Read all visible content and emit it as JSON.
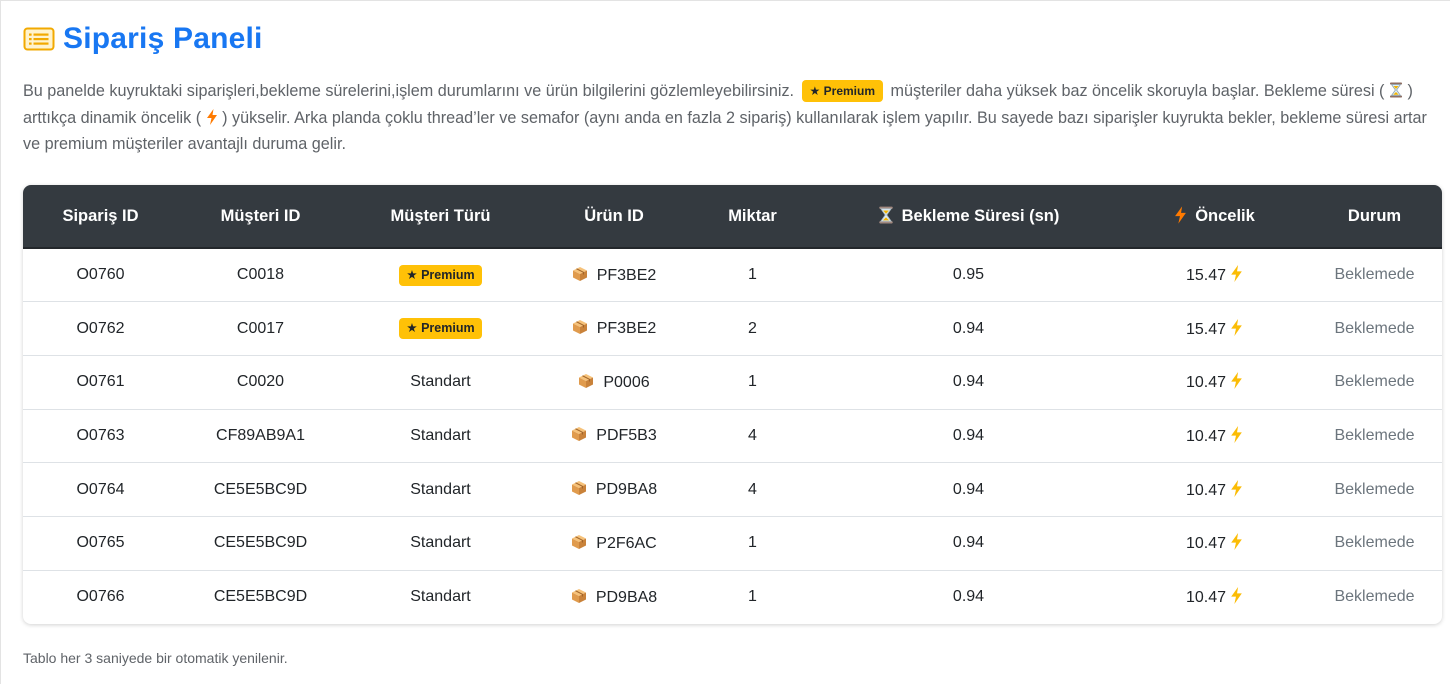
{
  "header": {
    "title": "Sipariş Paneli",
    "icon": "list-icon",
    "accent_color": "#1877f2"
  },
  "description": {
    "part1": "Bu panelde kuyruktaki siparişleri,bekleme sürelerini,işlem durumlarını ve ürün bilgilerini gözlemleyebilirsiniz.",
    "premium_badge": "★ Premium",
    "part2": "müşteriler daha yüksek baz öncelik skoruyla başlar. Bekleme süresi (",
    "part3": ") arttıkça dinamik öncelik (",
    "part4": ") yükselir. Arka planda çoklu thread’ler ve semafor (aynı anda en fazla 2 sipariş) kullanılarak işlem yapılır. Bu sayede bazı siparişler kuyrukta bekler, bekleme süresi artar ve premium müşteriler avantajlı duruma gelir."
  },
  "table": {
    "columns": [
      "Sipariş ID",
      "Müşteri ID",
      "Müşteri Türü",
      "Ürün ID",
      "Miktar",
      "Bekleme Süresi (sn)",
      "Öncelik",
      "Durum"
    ],
    "rows": [
      {
        "order_id": "O0760",
        "customer_id": "C0018",
        "customer_type": "★ Premium",
        "premium": true,
        "product_id": "PF3BE2",
        "quantity": "1",
        "wait": "0.95",
        "priority": "15.47",
        "status": "Beklemede"
      },
      {
        "order_id": "O0762",
        "customer_id": "C0017",
        "customer_type": "★ Premium",
        "premium": true,
        "product_id": "PF3BE2",
        "quantity": "2",
        "wait": "0.94",
        "priority": "15.47",
        "status": "Beklemede"
      },
      {
        "order_id": "O0761",
        "customer_id": "C0020",
        "customer_type": "Standart",
        "premium": false,
        "product_id": "P0006",
        "quantity": "1",
        "wait": "0.94",
        "priority": "10.47",
        "status": "Beklemede"
      },
      {
        "order_id": "O0763",
        "customer_id": "CF89AB9A1",
        "customer_type": "Standart",
        "premium": false,
        "product_id": "PDF5B3",
        "quantity": "4",
        "wait": "0.94",
        "priority": "10.47",
        "status": "Beklemede"
      },
      {
        "order_id": "O0764",
        "customer_id": "CE5E5BC9D",
        "customer_type": "Standart",
        "premium": false,
        "product_id": "PD9BA8",
        "quantity": "4",
        "wait": "0.94",
        "priority": "10.47",
        "status": "Beklemede"
      },
      {
        "order_id": "O0765",
        "customer_id": "CE5E5BC9D",
        "customer_type": "Standart",
        "premium": false,
        "product_id": "P2F6AC",
        "quantity": "1",
        "wait": "0.94",
        "priority": "10.47",
        "status": "Beklemede"
      },
      {
        "order_id": "O0766",
        "customer_id": "CE5E5BC9D",
        "customer_type": "Standart",
        "premium": false,
        "product_id": "PD9BA8",
        "quantity": "1",
        "wait": "0.94",
        "priority": "10.47",
        "status": "Beklemede"
      }
    ]
  },
  "footer": {
    "note": "Tablo her 3 saniyede bir otomatik yenilenir."
  },
  "colors": {
    "header_bg": "#343a40",
    "premium_badge": "#ffc107",
    "status_text": "#6c757d"
  }
}
